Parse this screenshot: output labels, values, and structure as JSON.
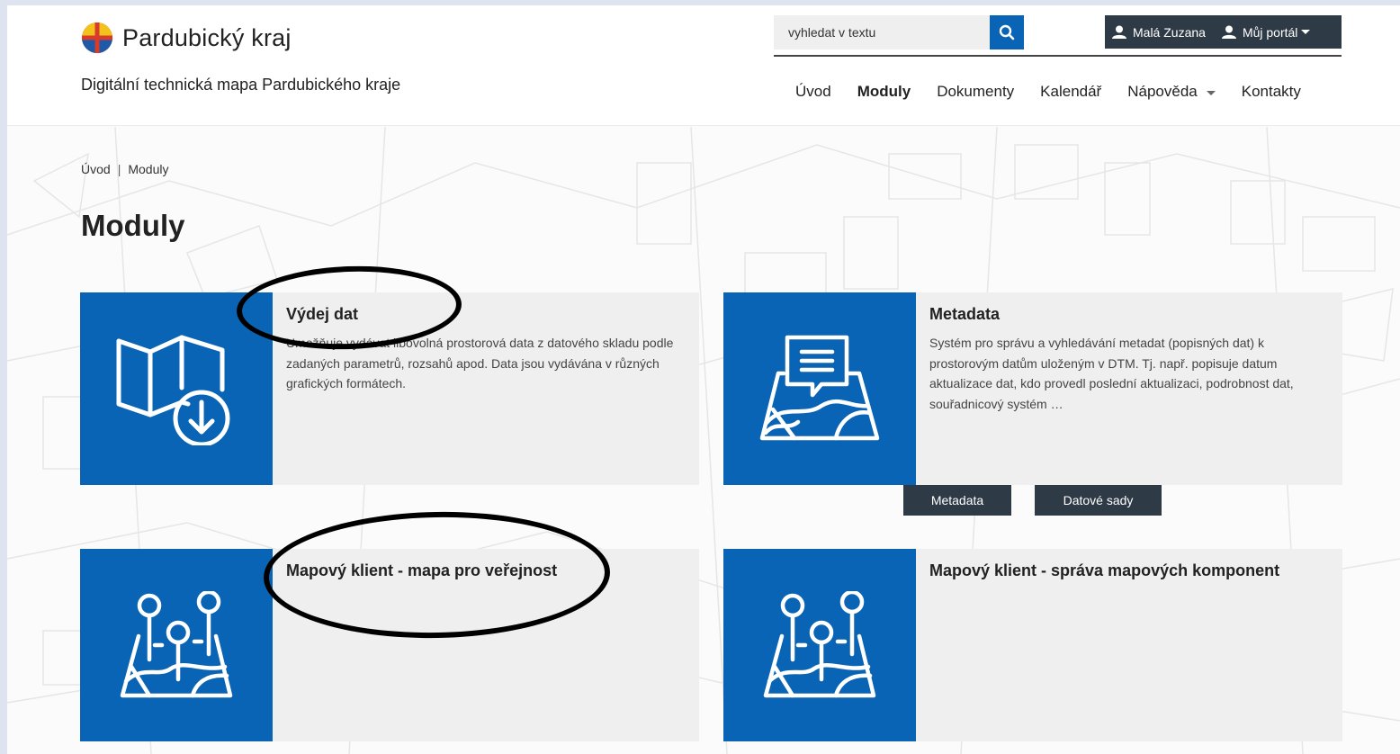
{
  "header": {
    "logo_text": "Pardubický kraj",
    "subtitle": "Digitální technická mapa Pardubického kraje",
    "search_placeholder": "vyhledat v textu",
    "user_name": "Malá Zuzana",
    "portal_label": "Můj portál"
  },
  "nav": {
    "items": [
      {
        "label": "Úvod",
        "active": false
      },
      {
        "label": "Moduly",
        "active": true
      },
      {
        "label": "Dokumenty",
        "active": false
      },
      {
        "label": "Kalendář",
        "active": false
      },
      {
        "label": "Nápověda",
        "active": false,
        "dropdown": true
      },
      {
        "label": "Kontakty",
        "active": false
      }
    ]
  },
  "breadcrumb": [
    "Úvod",
    "Moduly"
  ],
  "page_title": "Moduly",
  "modules": [
    {
      "title": "Výdej dat",
      "description": "Umožňuje vydávat libovolná prostorová data z datového skladu podle zadaných parametrů, rozsahů apod. Data jsou vydávána v různých grafických formátech.",
      "icon": "map-download-icon"
    },
    {
      "title": "Metadata",
      "description": "Systém pro správu a vyhledávání metadat (popisných dat) k prostorovým datům uloženým v DTM. Tj. např. popisuje datum aktualizace dat, kdo provedl poslední aktualizaci, podrobnost dat, souřadnicový systém …",
      "icon": "map-document-icon",
      "buttons": [
        "Metadata",
        "Datové sady"
      ]
    },
    {
      "title": "Mapový klient - mapa pro veřejnost",
      "description": "",
      "icon": "map-pins-icon"
    },
    {
      "title": "Mapový klient - správa mapových komponent",
      "description": "",
      "icon": "map-pins-icon"
    }
  ],
  "colors": {
    "brand_blue": "#0a64b5",
    "dark_bar": "#2f3a47",
    "card_bg": "#efefef"
  }
}
